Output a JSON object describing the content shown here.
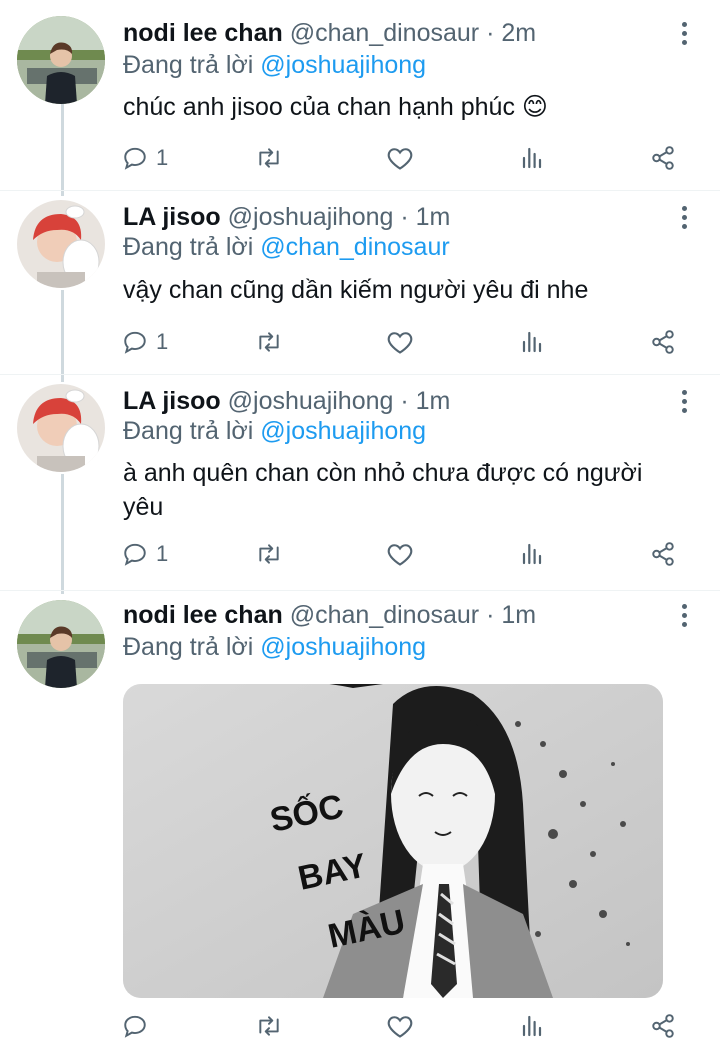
{
  "tweets": [
    {
      "name": "nodi lee chan",
      "handle": "@chan_dinosaur",
      "dot": "·",
      "time": "2m",
      "reply_prefix": "Đang trả lời",
      "reply_to": "@joshuajihong",
      "text": "chúc anh jisoo của chan hạnh phúc 😊",
      "reply_count": "1",
      "avatar_icon": "user-avatar-photo"
    },
    {
      "name": "LA jisoo",
      "handle": "@joshuajihong",
      "dot": "·",
      "time": "1m",
      "reply_prefix": "Đang trả lời",
      "reply_to": "@chan_dinosaur",
      "text": "vậy chan cũng dần kiếm người yêu đi nhe",
      "reply_count": "1",
      "avatar_icon": "user-avatar-photo"
    },
    {
      "name": "LA jisoo",
      "handle": "@joshuajihong",
      "dot": "·",
      "time": "1m",
      "reply_prefix": "Đang trả lời",
      "reply_to": "@joshuajihong",
      "text": "à anh quên chan còn nhỏ chưa được có người yêu",
      "reply_count": "1",
      "avatar_icon": "user-avatar-photo"
    },
    {
      "name": "nodi lee chan",
      "handle": "@chan_dinosaur",
      "dot": "·",
      "time": "1m",
      "reply_prefix": "Đang trả lời",
      "reply_to": "@joshuajihong",
      "reply_count": "",
      "avatar_icon": "user-avatar-photo",
      "media_caption": [
        "SỐC",
        "BAY",
        "MÀU"
      ]
    }
  ],
  "icons": {
    "reply": "reply-icon",
    "retweet": "retweet-icon",
    "like": "heart-icon",
    "analytics": "analytics-icon",
    "share": "share-icon",
    "more": "more-icon"
  },
  "colors": {
    "accent": "#1d9bf0",
    "secondary_text": "#536471",
    "thread_line": "#cfd9de"
  }
}
